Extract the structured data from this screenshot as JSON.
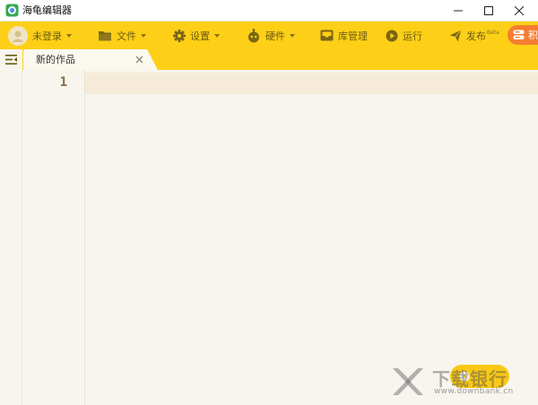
{
  "window": {
    "title": "海龟编辑器"
  },
  "toolbar": {
    "user_label": "未登录",
    "file_label": "文件",
    "settings_label": "设置",
    "hardware_label": "硬件",
    "library_label": "库管理",
    "run_label": "运行",
    "publish_label": "发布",
    "publish_badge": "Beta",
    "special_label": "积"
  },
  "tabs": [
    {
      "label": "新的作品"
    }
  ],
  "editor": {
    "line_numbers": [
      "1"
    ]
  },
  "watermark": {
    "title": "下载银行",
    "url": "www.downbank.cn"
  },
  "colors": {
    "toolbar_bg": "#fdd017",
    "editor_bg": "#f7f5ee",
    "current_line": "#f5ebd8",
    "special_button": "#f57d2f",
    "run_button": "#f9c916"
  }
}
